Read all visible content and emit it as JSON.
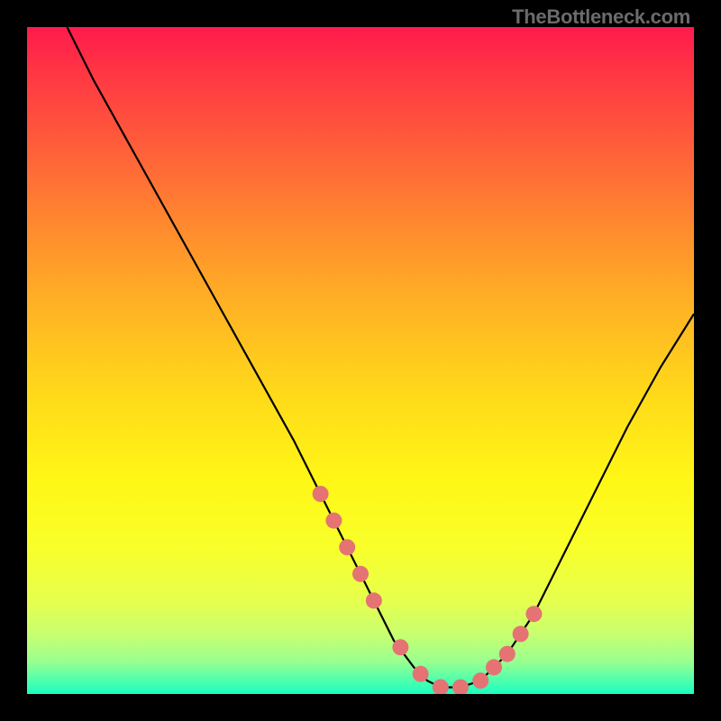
{
  "watermark": "TheBottleneck.com",
  "chart_data": {
    "type": "line",
    "title": "",
    "xlabel": "",
    "ylabel": "",
    "xlim": [
      0,
      100
    ],
    "ylim": [
      0,
      100
    ],
    "curve": {
      "name": "bottleneck-curve",
      "x": [
        6,
        10,
        15,
        20,
        25,
        30,
        35,
        40,
        44,
        48,
        52,
        55,
        58,
        60,
        62,
        65,
        68,
        72,
        76,
        80,
        85,
        90,
        95,
        100
      ],
      "y": [
        100,
        92,
        83,
        74,
        65,
        56,
        47,
        38,
        30,
        22,
        14,
        8,
        4,
        2,
        1,
        1,
        2,
        6,
        12,
        20,
        30,
        40,
        49,
        57
      ]
    },
    "markers": {
      "name": "highlight-points",
      "color": "#e57373",
      "radius": 9,
      "x": [
        44,
        46,
        48,
        50,
        52,
        56,
        59,
        62,
        65,
        68,
        70,
        72,
        74,
        76
      ],
      "y": [
        30,
        26,
        22,
        18,
        14,
        7,
        3,
        1,
        1,
        2,
        4,
        6,
        9,
        12
      ]
    },
    "background_gradient": {
      "top": "#ff1a4d",
      "bottom": "#1affc2"
    }
  }
}
